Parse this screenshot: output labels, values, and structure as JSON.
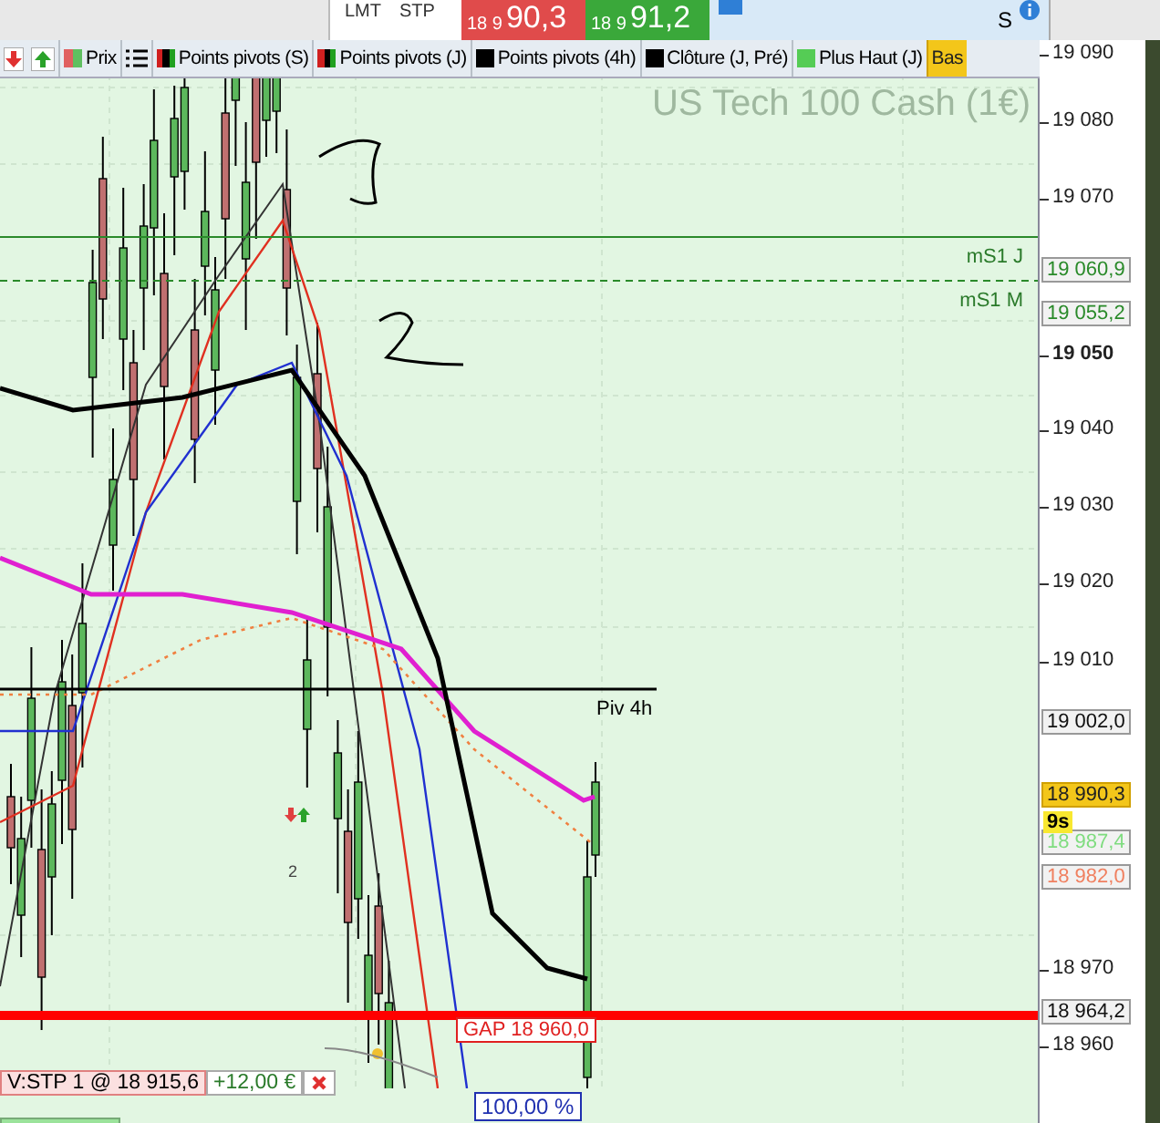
{
  "order_bar": {
    "types": [
      "LMT",
      "STP"
    ],
    "sell": {
      "prefix": "18 9",
      "price": "90,3"
    },
    "buy": {
      "prefix": "18 9",
      "price": "91,2"
    },
    "preset_checked": true,
    "panel_text": "S"
  },
  "legend": [
    {
      "kind": "price",
      "label": "Prix"
    },
    {
      "kind": "list"
    },
    {
      "kind": "pivots",
      "label": "Points pivots (S)"
    },
    {
      "kind": "pivots",
      "label": "Points pivots (J)"
    },
    {
      "kind": "solid",
      "color": "#000000",
      "label": "Points pivots (4h)"
    },
    {
      "kind": "solid",
      "color": "#000000",
      "label": "Clôture (J, Pré)"
    },
    {
      "kind": "solid",
      "color": "#55cc55",
      "label": "Plus Haut (J)"
    },
    {
      "kind": "text",
      "label": "Bas"
    }
  ],
  "chart": {
    "instrument": "US Tech 100 Cash (1€)",
    "levels": [
      {
        "label": "mS1 J",
        "kind": "solid"
      },
      {
        "label": "mS1 M",
        "kind": "dashed"
      },
      {
        "label": "Piv 4h",
        "kind": "short"
      },
      {
        "label": "GAP 18 960,0",
        "kind": "gap"
      }
    ],
    "trade_count": "2",
    "order": {
      "label": "V:STP  1  @  18 915,6",
      "profit": "+12,00 €"
    },
    "fill_label": "100,00 %"
  },
  "axis": {
    "ticks": [
      {
        "label": "19 090",
        "bold": false
      },
      {
        "label": "19 080",
        "bold": false
      },
      {
        "label": "19 070",
        "bold": false
      },
      {
        "label": "19 050",
        "bold": true
      },
      {
        "label": "19 040",
        "bold": false
      },
      {
        "label": "19 030",
        "bold": false
      },
      {
        "label": "19 020",
        "bold": false
      },
      {
        "label": "19 010",
        "bold": false
      },
      {
        "label": "18 970",
        "bold": false
      },
      {
        "label": "18 960",
        "bold": false
      }
    ],
    "tags": [
      {
        "label": "19 060,9",
        "kind": "support"
      },
      {
        "label": "19 055,2",
        "kind": "support"
      },
      {
        "label": "19 002,0",
        "kind": "pivot"
      },
      {
        "label": "18 990,3",
        "kind": "last"
      },
      {
        "label": "18 987,4",
        "kind": "average"
      },
      {
        "label": "18 982,0",
        "kind": "average2"
      },
      {
        "label": "18 964,2",
        "kind": "pivot"
      }
    ],
    "timer": "9s"
  }
}
